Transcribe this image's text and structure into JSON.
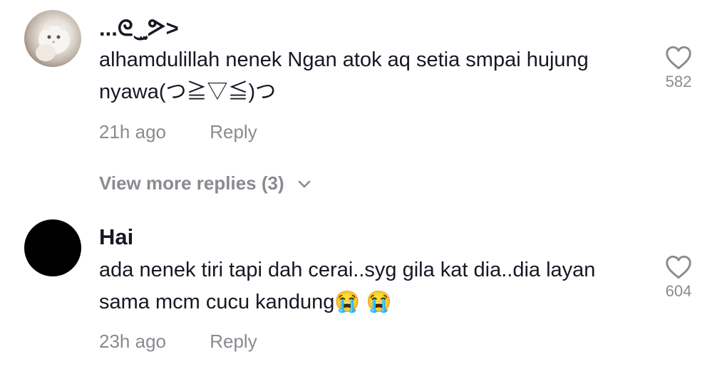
{
  "comments": [
    {
      "username": "...ᘓ‿̫ᕗ>",
      "text": "alhamdulillah nenek Ngan atok aq setia smpai hujung nyawa(つ≧▽≦)つ",
      "time": "21h ago",
      "reply_label": "Reply",
      "likes": "582",
      "avatar_icon": "cat-avatar",
      "view_more": "View more replies (3)"
    },
    {
      "username": "Hai",
      "text": "ada nenek tiri tapi dah cerai..syg gila kat dia..dia layan sama mcm cucu kandung😭 😭",
      "time": "23h ago",
      "reply_label": "Reply",
      "likes": "604",
      "avatar_icon": "black-avatar"
    }
  ],
  "colors": {
    "text": "#161823",
    "secondary": "#8a8b91",
    "background": "#ffffff"
  }
}
